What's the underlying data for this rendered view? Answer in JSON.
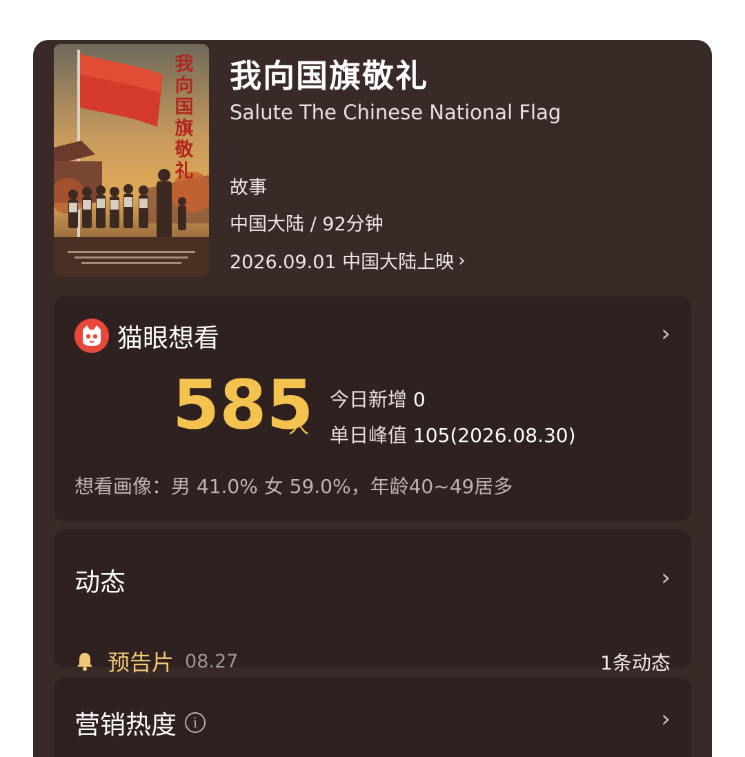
{
  "movie": {
    "poster_title": "我向国旗敬礼",
    "title": "我向国旗敬礼",
    "subtitle": "Salute The Chinese National Flag",
    "genre": "故事",
    "region_duration": "中国大陆 / 92分钟",
    "release": "2026.09.01 中国大陆上映"
  },
  "want_to_see": {
    "label": "猫眼想看",
    "count": "585",
    "unit": "人",
    "today_label": "今日新增",
    "today_value": "0",
    "peak_label": "单日峰值",
    "peak_value": "105(2026.08.30)",
    "profile": "想看画像：男 41.0%  女 59.0%，年龄40~49居多"
  },
  "news": {
    "label": "动态",
    "item_label": "预告片",
    "item_date": "08.27",
    "count": "1条动态"
  },
  "marketing": {
    "label": "营销热度",
    "info_glyph": "i"
  },
  "icons": {
    "chevron": "›"
  },
  "colors": {
    "card_bg": "#3a2a27",
    "panel_bg": "#2f211f",
    "accent_yellow": "#f4c24e",
    "maoyan_red": "#e8473c"
  }
}
